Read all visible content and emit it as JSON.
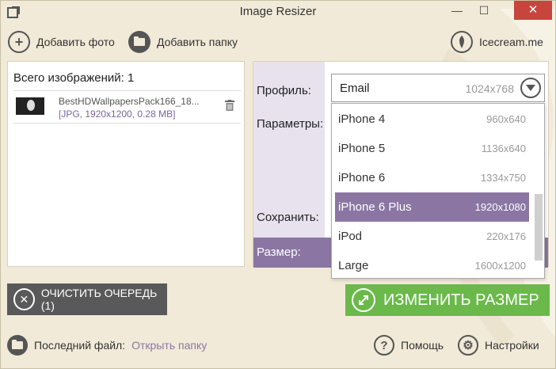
{
  "window": {
    "title": "Image Resizer",
    "min_glyph": "—",
    "max_glyph": "☐",
    "close_glyph": "✕"
  },
  "toolbar": {
    "add_photo": "Добавить фото",
    "add_folder": "Добавить папку",
    "brand": "Icecream.me"
  },
  "left_panel": {
    "count_label": "Всего изображений: 1",
    "files": [
      {
        "name": "BestHDWallpapersPack166_18...",
        "meta": "[JPG, 1920x1200, 0.28 MB]"
      }
    ]
  },
  "right_panel": {
    "profile_label": "Профиль:",
    "params_label": "Параметры:",
    "save_label": "Сохранить:",
    "size_label": "Размер:",
    "profile": {
      "name": "Email",
      "resolution": "1024x768"
    }
  },
  "dropdown": {
    "items": [
      {
        "name": "iPhone 4",
        "res": "960x640"
      },
      {
        "name": "iPhone 5",
        "res": "1136x640"
      },
      {
        "name": "iPhone 6",
        "res": "1334x750"
      },
      {
        "name": "iPhone 6 Plus",
        "res": "1920x1080"
      },
      {
        "name": "iPod",
        "res": "220x176"
      },
      {
        "name": "Large",
        "res": "1600x1200"
      }
    ],
    "selected": "iPhone 6 Plus"
  },
  "buttons": {
    "clear_queue": "ОЧИСТИТЬ ОЧЕРЕДЬ (1)",
    "resize": "ИЗМЕНИТЬ РАЗМЕР"
  },
  "footer": {
    "last_file_label": "Последний файл:",
    "open_folder": "Открыть папку",
    "help": "Помощь",
    "settings": "Настройки"
  },
  "colors": {
    "background": "#f1ead8",
    "accent_purple": "#8b76a3",
    "resize_green": "#6ab94a",
    "clear_gray": "#595959",
    "close_red": "#c7453d"
  }
}
